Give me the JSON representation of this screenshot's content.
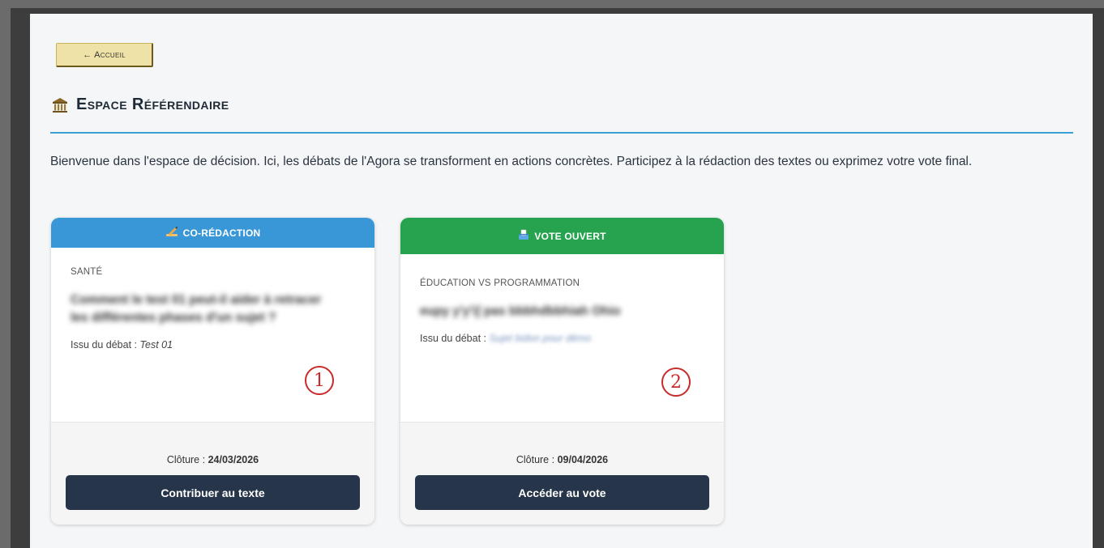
{
  "nav": {
    "back_label": "← Accueil"
  },
  "header": {
    "title": "Espace Référendaire",
    "icon": "classical-building-icon"
  },
  "intro": "Bienvenue dans l'espace de décision. Ici, les débats de l'Agora se transforment en actions concrètes. Participez à la rédaction des textes ou exprimez votre vote final.",
  "cards": [
    {
      "status_icon": "writing-hand-icon",
      "status_label": "CO-RÉDACTION",
      "status_color": "#3997d8",
      "category": "SANTÉ",
      "subject": "Comment le test 01 peut-il aider à retracer les différentes phases d'un sujet ?",
      "origin_label": "Issu du débat :",
      "origin_debate": "Test 01",
      "badge": "1",
      "closing_label": "Clôture :",
      "closing_date": "24/03/2026",
      "action_label": "Contribuer au texte"
    },
    {
      "status_icon": "ballot-box-icon",
      "status_label": "VOTE OUVERT",
      "status_color": "#27a350",
      "category": "ÉDUCATION VS PROGRAMMATION",
      "subject": "eupy y'y'iʃ pas bbbhdbbhiah Ohio",
      "origin_label": "Issu du débat :",
      "origin_debate": "Sujet bidon pour démo",
      "badge": "2",
      "closing_label": "Clôture :",
      "closing_date": "09/04/2026",
      "action_label": "Accéder au vote"
    }
  ],
  "colors": {
    "accent_rule": "#3a9fd5",
    "button_dark": "#263549",
    "back_button_bg": "#efe2a6",
    "badge_red": "#c92a2a"
  }
}
